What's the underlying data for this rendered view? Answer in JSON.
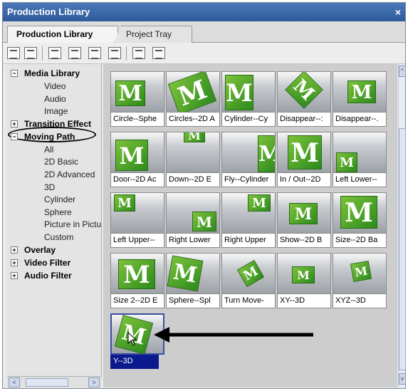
{
  "window": {
    "title": "Production Library",
    "close_glyph": "×"
  },
  "tabs": [
    {
      "label": "Production Library",
      "active": true
    },
    {
      "label": "Project Tray",
      "active": false
    }
  ],
  "toolbar_icons": [
    "list-view-icon",
    "grid-view-icon",
    "new-item-icon",
    "move-icon",
    "add-icon",
    "edit-icon",
    "preview-icon",
    "properties-icon"
  ],
  "tree": {
    "groups": [
      {
        "label": "Media Library",
        "expander": "−",
        "children": [
          "Video",
          "Audio",
          "Image"
        ]
      },
      {
        "label": "Transition Effect",
        "expander": "+",
        "children": []
      },
      {
        "label": "Moving Path",
        "expander": "−",
        "children": [
          "All",
          "2D Basic",
          "2D Advanced",
          "3D",
          "Cylinder",
          "Sphere",
          "Picture in Pictu",
          "Custom"
        ]
      },
      {
        "label": "Overlay",
        "expander": "+",
        "children": []
      },
      {
        "label": "Video Filter",
        "expander": "+",
        "children": []
      },
      {
        "label": "Audio Filter",
        "expander": "+",
        "children": []
      }
    ]
  },
  "items": [
    {
      "caption": "Circle--Sphe",
      "thumb_letter": "M"
    },
    {
      "caption": "Circles--2D A",
      "thumb_letter": "M"
    },
    {
      "caption": "Cylinder--Cy",
      "thumb_letter": "M"
    },
    {
      "caption": "Disappear--:",
      "thumb_letter": "M"
    },
    {
      "caption": "Disappear--.",
      "thumb_letter": "M"
    },
    {
      "caption": "Door--2D Ac",
      "thumb_letter": "M"
    },
    {
      "caption": "Down--2D E",
      "thumb_letter": "M"
    },
    {
      "caption": "Fly--Cylinder",
      "thumb_letter": "M"
    },
    {
      "caption": "In / Out--2D",
      "thumb_letter": "M"
    },
    {
      "caption": "Left Lower--",
      "thumb_letter": "M"
    },
    {
      "caption": "Left Upper--",
      "thumb_letter": "M"
    },
    {
      "caption": "Right Lower",
      "thumb_letter": "M"
    },
    {
      "caption": "Right Upper",
      "thumb_letter": "M"
    },
    {
      "caption": "Show--2D B",
      "thumb_letter": "M"
    },
    {
      "caption": "Size--2D Ba",
      "thumb_letter": "M"
    },
    {
      "caption": "Size 2--2D E",
      "thumb_letter": "M"
    },
    {
      "caption": "Sphere--Spl",
      "thumb_letter": "M"
    },
    {
      "caption": "Turn Move-",
      "thumb_letter": "M"
    },
    {
      "caption": "XY--3D",
      "thumb_letter": "M"
    },
    {
      "caption": "XYZ--3D",
      "thumb_letter": "M"
    },
    {
      "caption": "Y--3D",
      "thumb_letter": "M",
      "selected": true
    }
  ],
  "scrollbars": {
    "left_glyph": "<",
    "right_glyph": ">",
    "up_glyph": "^",
    "down_glyph": "v"
  },
  "colors": {
    "selection": "#0a1a8c",
    "titlebar": "#3a68ac",
    "thumb_green": "#4ea82a"
  }
}
